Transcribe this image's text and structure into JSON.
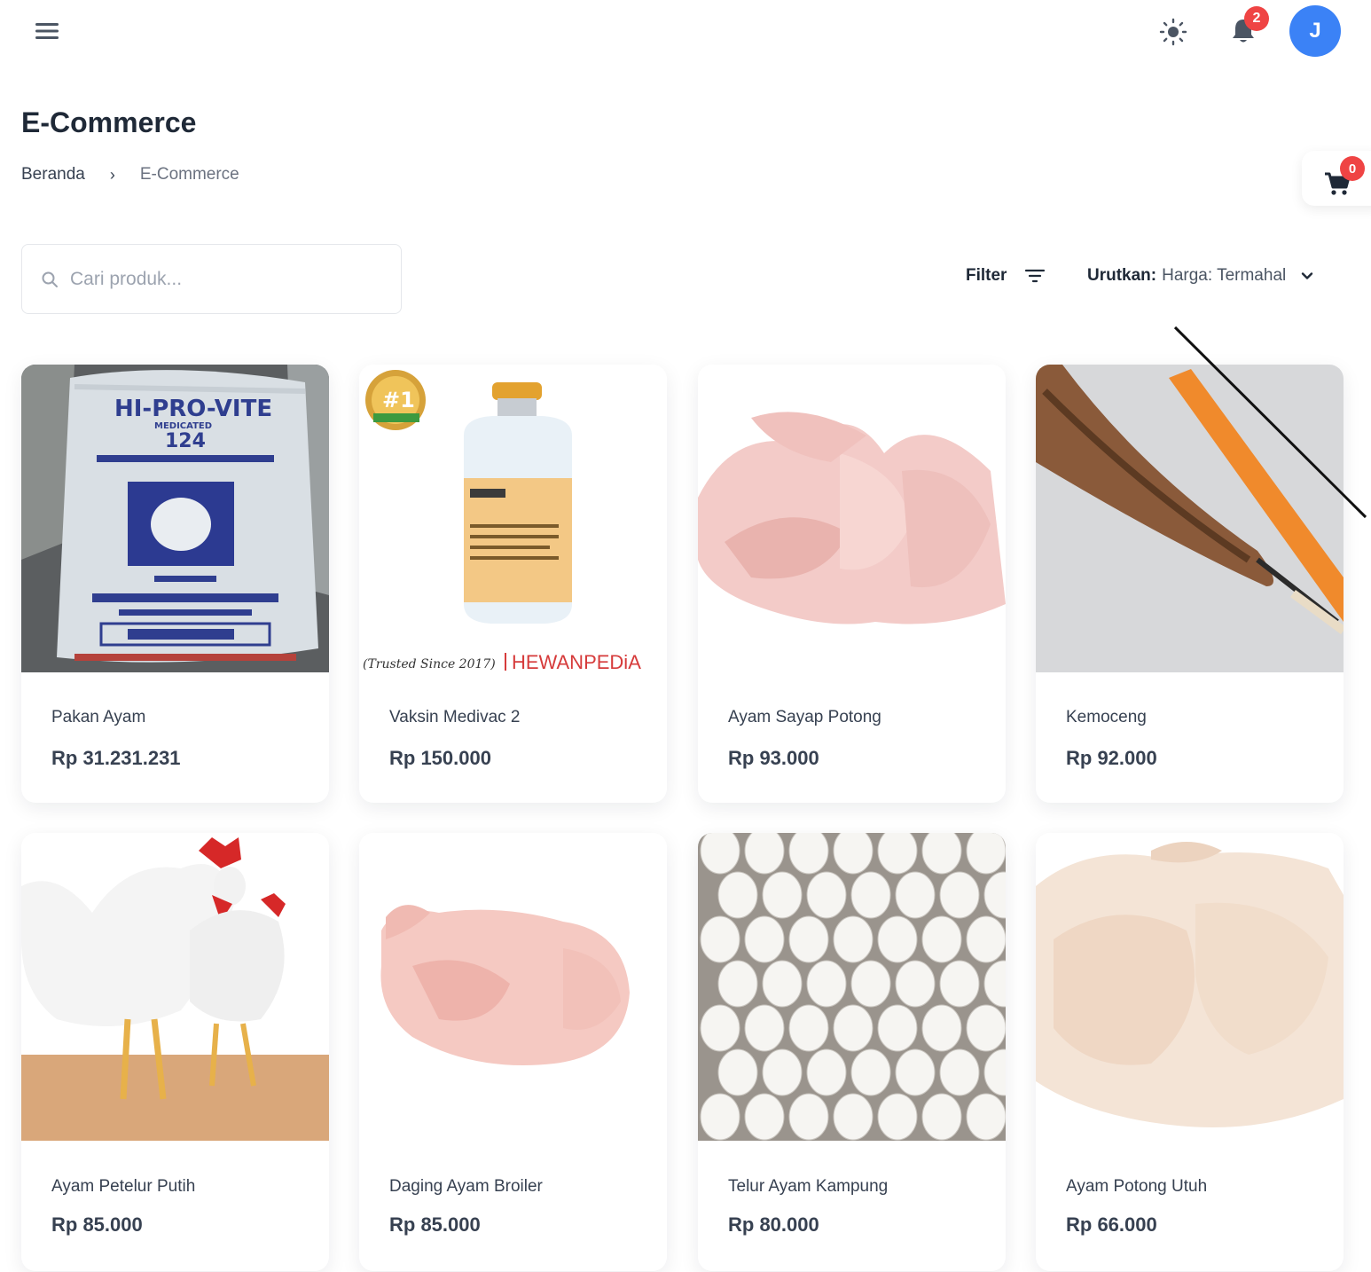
{
  "header": {
    "notification_count": "2",
    "avatar_initial": "J",
    "icons": [
      "menu-icon",
      "sun-icon",
      "bell-icon"
    ]
  },
  "page": {
    "title": "E-Commerce",
    "breadcrumb": {
      "home": "Beranda",
      "separator": "›",
      "current": "E-Commerce"
    }
  },
  "cart": {
    "count": "0",
    "icon": "cart-icon"
  },
  "search": {
    "placeholder": "Cari produk...",
    "value": ""
  },
  "toolbar": {
    "filter_label": "Filter",
    "sort_label": "Urutkan:",
    "sort_value": "Harga: Termahal"
  },
  "products": [
    {
      "name": "Pakan Ayam",
      "price": "Rp 31.231.231"
    },
    {
      "name": "Vaksin Medivac 2",
      "price": "Rp 150.000"
    },
    {
      "name": "Ayam Sayap Potong",
      "price": "Rp 93.000"
    },
    {
      "name": "Kemoceng",
      "price": "Rp 92.000"
    },
    {
      "name": "Ayam Petelur Putih",
      "price": "Rp 85.000"
    },
    {
      "name": "Daging Ayam Broiler",
      "price": "Rp 85.000"
    },
    {
      "name": "Telur Ayam Kampung",
      "price": "Rp 80.000"
    },
    {
      "name": "Ayam Potong Utuh",
      "price": "Rp 66.000"
    }
  ],
  "image_text": {
    "feed_bag_brand": "HI-PRO-VITE",
    "feed_bag_sub": "MEDICATED",
    "feed_bag_code": "124",
    "vaccine_badge": "#1",
    "vaccine_tagline": "(Trusted Since 2017)",
    "vaccine_brand": "HEWANPEDiA"
  },
  "colors": {
    "accent": "#3b82f6",
    "badge": "#ef4444",
    "text": "#1f2937",
    "muted": "#9ca3af"
  }
}
